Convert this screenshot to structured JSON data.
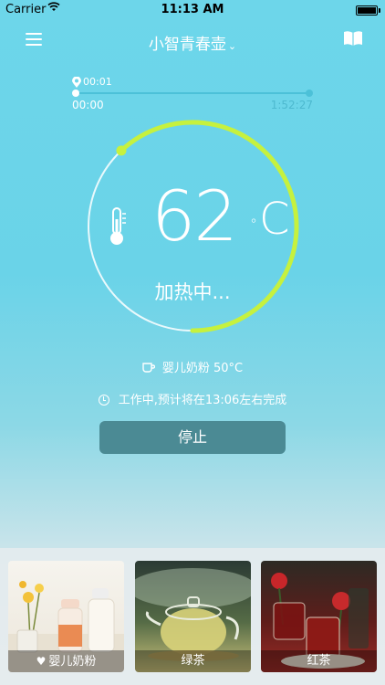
{
  "status_bar": {
    "carrier": "Carrier",
    "time": "11:13 AM"
  },
  "nav": {
    "title": "小智青春壶"
  },
  "progress": {
    "current_marker": "00:01",
    "start": "00:00",
    "end": "1:52:27",
    "fraction": 0.0
  },
  "dial": {
    "temperature": "62",
    "unit": "C",
    "state": "加热中...",
    "arc_fraction": 0.62
  },
  "mode": {
    "text": "婴儿奶粉 50°C"
  },
  "eta": {
    "text": "工作中,预计将在13:06左右完成"
  },
  "stop_label": "停止",
  "cards": [
    {
      "label": "婴儿奶粉",
      "favorite": true
    },
    {
      "label": "绿茶",
      "favorite": false
    },
    {
      "label": "红茶",
      "favorite": false
    }
  ],
  "colors": {
    "accent_arc": "#c6f13e",
    "stop_button": "#4b8a94",
    "background": "#6dd6ea"
  }
}
